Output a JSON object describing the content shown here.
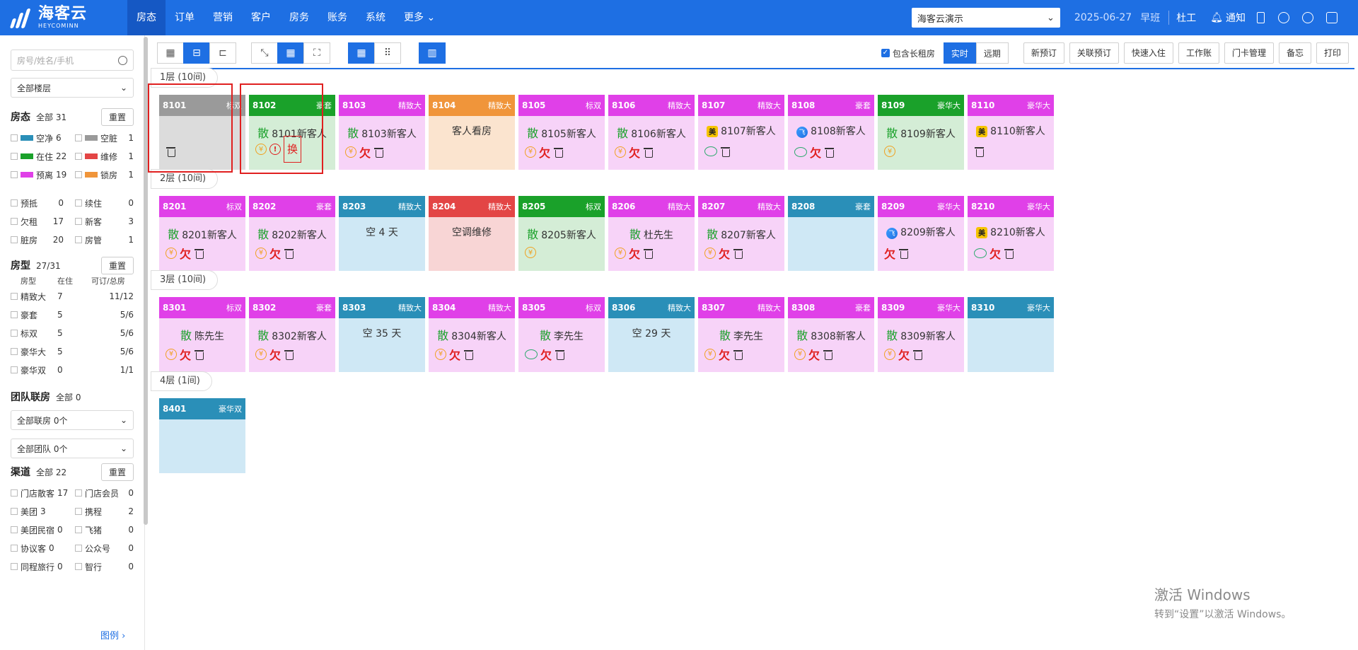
{
  "app": {
    "logo_title": "海客云",
    "logo_sub": "HEYCOMINN"
  },
  "nav": [
    "房态",
    "订单",
    "营销",
    "客户",
    "房务",
    "账务",
    "系统",
    "更多"
  ],
  "topbar": {
    "hotel": "海客云演示",
    "date": "2025-06-27",
    "shift": "早班",
    "user": "杜工",
    "notify": "通知"
  },
  "sidebar": {
    "search_placeholder": "房号/姓名/手机",
    "floor_select": "全部楼层",
    "status_title": "房态",
    "status_count": "全部 31",
    "reset": "重置",
    "status_items": [
      {
        "label": "空净",
        "count": "6",
        "color": "#2a8fb8"
      },
      {
        "label": "空脏",
        "count": "1",
        "color": "#9a9a9a"
      },
      {
        "label": "在住",
        "count": "22",
        "color": "#1aa12a"
      },
      {
        "label": "维修",
        "count": "1",
        "color": "#e34545"
      },
      {
        "label": "预离",
        "count": "19",
        "color": "#e040e8"
      },
      {
        "label": "锁房",
        "count": "1",
        "color": "#f0953a"
      }
    ],
    "flags": [
      {
        "label": "预抵",
        "count": "0"
      },
      {
        "label": "续住",
        "count": "0"
      },
      {
        "label": "欠租",
        "count": "17"
      },
      {
        "label": "新客",
        "count": "3"
      },
      {
        "label": "脏房",
        "count": "20"
      },
      {
        "label": "房管",
        "count": "1"
      }
    ],
    "roomtype_title": "房型",
    "roomtype_count": "27/31",
    "rt_cols": [
      "房型",
      "在住",
      "可订/总房"
    ],
    "roomtypes": [
      {
        "name": "精致大",
        "in": "7",
        "avail": "11/12"
      },
      {
        "name": "豪套",
        "in": "5",
        "avail": "5/6"
      },
      {
        "name": "标双",
        "in": "5",
        "avail": "5/6"
      },
      {
        "name": "豪华大",
        "in": "5",
        "avail": "5/6"
      },
      {
        "name": "豪华双",
        "in": "0",
        "avail": "1/1"
      }
    ],
    "group_title": "团队联房",
    "group_count": "全部 0",
    "group_sel1": "全部联房 0个",
    "group_sel2": "全部团队 0个",
    "channel_title": "渠道",
    "channel_count": "全部 22",
    "channels": [
      {
        "label": "门店散客",
        "count": "17"
      },
      {
        "label": "门店会员",
        "count": "0"
      },
      {
        "label": "美团",
        "count": "3"
      },
      {
        "label": "携程",
        "count": "2"
      },
      {
        "label": "美团民宿",
        "count": "0"
      },
      {
        "label": "飞猪",
        "count": "0"
      },
      {
        "label": "协议客",
        "count": "0"
      },
      {
        "label": "公众号",
        "count": "0"
      },
      {
        "label": "同程旅行",
        "count": "0"
      },
      {
        "label": "智行",
        "count": "0"
      }
    ],
    "legend": "图例"
  },
  "toolbar": {
    "long_rent": "包含长租房",
    "realtime": "实时",
    "future": "远期",
    "actions": [
      "新预订",
      "关联预订",
      "快速入住",
      "工作账",
      "门卡管理",
      "备忘",
      "打印"
    ]
  },
  "floors": [
    {
      "label": "1层 (10间)",
      "rooms": [
        {
          "no": "8101",
          "type": "标双",
          "color": "#9a9a9a",
          "bg": "#dcdcdc",
          "main": "",
          "san": false,
          "icons": [
            "trash"
          ]
        },
        {
          "no": "8102",
          "type": "豪套",
          "color": "#1aa12a",
          "bg": "#d4edd6",
          "main": "8101新客人",
          "san": true,
          "icons": [
            "yen",
            "alert",
            "huan"
          ]
        },
        {
          "no": "8103",
          "type": "精致大",
          "color": "#e040e8",
          "bg": "#f7d3f8",
          "main": "8103新客人",
          "san": true,
          "icons": [
            "yen",
            "qian",
            "trash"
          ]
        },
        {
          "no": "8104",
          "type": "精致大",
          "color": "#f0953a",
          "bg": "#fbe4cf",
          "main": "客人看房",
          "san": false,
          "icons": []
        },
        {
          "no": "8105",
          "type": "标双",
          "color": "#e040e8",
          "bg": "#f7d3f8",
          "main": "8105新客人",
          "san": true,
          "icons": [
            "yen",
            "qian",
            "trash"
          ]
        },
        {
          "no": "8106",
          "type": "精致大",
          "color": "#e040e8",
          "bg": "#f7d3f8",
          "main": "8106新客人",
          "san": true,
          "icons": [
            "yen",
            "qian",
            "trash"
          ]
        },
        {
          "no": "8107",
          "type": "精致大",
          "color": "#e040e8",
          "bg": "#f7d3f8",
          "main": "8107新客人",
          "san": false,
          "badge": "mei",
          "icons": [
            "chat",
            "trash"
          ]
        },
        {
          "no": "8108",
          "type": "豪套",
          "color": "#e040e8",
          "bg": "#f7d3f8",
          "main": "8108新客人",
          "san": false,
          "badge": "fz",
          "icons": [
            "chat",
            "qian",
            "trash"
          ]
        },
        {
          "no": "8109",
          "type": "豪华大",
          "color": "#1aa12a",
          "bg": "#d4edd6",
          "main": "8109新客人",
          "san": true,
          "icons": [
            "yen"
          ]
        },
        {
          "no": "8110",
          "type": "豪华大",
          "color": "#e040e8",
          "bg": "#f7d3f8",
          "main": "8110新客人",
          "san": false,
          "badge": "mei",
          "icons": [
            "trash"
          ]
        }
      ]
    },
    {
      "label": "2层 (10间)",
      "rooms": [
        {
          "no": "8201",
          "type": "标双",
          "color": "#e040e8",
          "bg": "#f7d3f8",
          "main": "8201新客人",
          "san": true,
          "icons": [
            "yen",
            "qian",
            "trash"
          ]
        },
        {
          "no": "8202",
          "type": "豪套",
          "color": "#e040e8",
          "bg": "#f7d3f8",
          "main": "8202新客人",
          "san": true,
          "icons": [
            "yen",
            "qian",
            "trash"
          ]
        },
        {
          "no": "8203",
          "type": "精致大",
          "color": "#2a8fb8",
          "bg": "#cfe8f5",
          "main": "空 4 天",
          "san": false,
          "icons": []
        },
        {
          "no": "8204",
          "type": "精致大",
          "color": "#e34545",
          "bg": "#f8d5d5",
          "main": "空调维修",
          "san": false,
          "icons": []
        },
        {
          "no": "8205",
          "type": "标双",
          "color": "#1aa12a",
          "bg": "#d4edd6",
          "main": "8205新客人",
          "san": true,
          "icons": [
            "yen"
          ]
        },
        {
          "no": "8206",
          "type": "精致大",
          "color": "#e040e8",
          "bg": "#f7d3f8",
          "main": "杜先生",
          "san": true,
          "icons": [
            "yen",
            "qian",
            "trash"
          ]
        },
        {
          "no": "8207",
          "type": "精致大",
          "color": "#e040e8",
          "bg": "#f7d3f8",
          "main": "8207新客人",
          "san": true,
          "icons": [
            "yen",
            "qian",
            "trash"
          ]
        },
        {
          "no": "8208",
          "type": "豪套",
          "color": "#2a8fb8",
          "bg": "#cfe8f5",
          "main": "",
          "san": false,
          "icons": []
        },
        {
          "no": "8209",
          "type": "豪华大",
          "color": "#e040e8",
          "bg": "#f7d3f8",
          "main": "8209新客人",
          "san": false,
          "badge": "fz",
          "icons": [
            "qian",
            "trash"
          ]
        },
        {
          "no": "8210",
          "type": "豪华大",
          "color": "#e040e8",
          "bg": "#f7d3f8",
          "main": "8210新客人",
          "san": false,
          "badge": "mei",
          "icons": [
            "chat",
            "qian",
            "trash"
          ]
        }
      ]
    },
    {
      "label": "3层 (10间)",
      "rooms": [
        {
          "no": "8301",
          "type": "标双",
          "color": "#e040e8",
          "bg": "#f7d3f8",
          "main": "陈先生",
          "san": true,
          "icons": [
            "yen",
            "qian",
            "trash"
          ]
        },
        {
          "no": "8302",
          "type": "豪套",
          "color": "#e040e8",
          "bg": "#f7d3f8",
          "main": "8302新客人",
          "san": true,
          "icons": [
            "yen",
            "qian",
            "trash"
          ]
        },
        {
          "no": "8303",
          "type": "精致大",
          "color": "#2a8fb8",
          "bg": "#cfe8f5",
          "main": "空 35 天",
          "san": false,
          "icons": []
        },
        {
          "no": "8304",
          "type": "精致大",
          "color": "#e040e8",
          "bg": "#f7d3f8",
          "main": "8304新客人",
          "san": true,
          "icons": [
            "yen",
            "qian",
            "trash"
          ]
        },
        {
          "no": "8305",
          "type": "标双",
          "color": "#e040e8",
          "bg": "#f7d3f8",
          "main": "李先生",
          "san": true,
          "icons": [
            "chat",
            "qian",
            "trash"
          ]
        },
        {
          "no": "8306",
          "type": "精致大",
          "color": "#2a8fb8",
          "bg": "#cfe8f5",
          "main": "空 29 天",
          "san": false,
          "icons": []
        },
        {
          "no": "8307",
          "type": "精致大",
          "color": "#e040e8",
          "bg": "#f7d3f8",
          "main": "李先生",
          "san": true,
          "icons": [
            "yen",
            "qian",
            "trash"
          ]
        },
        {
          "no": "8308",
          "type": "豪套",
          "color": "#e040e8",
          "bg": "#f7d3f8",
          "main": "8308新客人",
          "san": true,
          "icons": [
            "yen",
            "qian",
            "trash"
          ]
        },
        {
          "no": "8309",
          "type": "豪华大",
          "color": "#e040e8",
          "bg": "#f7d3f8",
          "main": "8309新客人",
          "san": true,
          "icons": [
            "yen",
            "qian",
            "trash"
          ]
        },
        {
          "no": "8310",
          "type": "豪华大",
          "color": "#2a8fb8",
          "bg": "#cfe8f5",
          "main": "",
          "san": false,
          "icons": []
        }
      ]
    },
    {
      "label": "4层 (1间)",
      "rooms": [
        {
          "no": "8401",
          "type": "豪华双",
          "color": "#2a8fb8",
          "bg": "#cfe8f5",
          "main": "",
          "san": false,
          "icons": []
        }
      ]
    }
  ],
  "glyphs": {
    "san": "散",
    "qian": "欠",
    "huan": "换",
    "yen": "¥",
    "alert": "!",
    "mei": "美",
    "fz": "飞"
  },
  "watermark": {
    "line1": "激活 Windows",
    "line2": "转到“设置”以激活 Windows。"
  }
}
